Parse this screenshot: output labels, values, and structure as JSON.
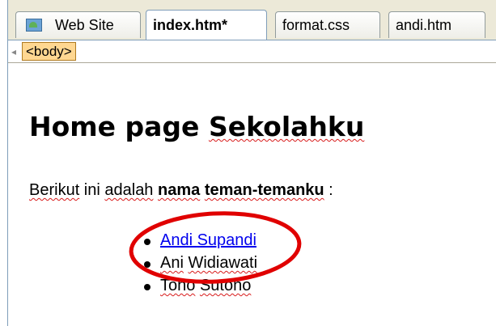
{
  "tabs": [
    {
      "label": "Web Site",
      "active": false
    },
    {
      "label": "index.htm*",
      "active": true
    },
    {
      "label": "format.css",
      "active": false
    },
    {
      "label": "andi.htm",
      "active": false
    }
  ],
  "tag_selector": {
    "tag": "<body>"
  },
  "page": {
    "heading_part1": "Home page ",
    "heading_part2": "Sekolahku",
    "intro_1": "Berikut",
    "intro_2": " ini ",
    "intro_3": "adalah",
    "intro_4": "nama",
    "intro_5": "teman-temanku",
    "intro_6": " :",
    "friends": [
      {
        "first": "Andi",
        "last": "Supandi",
        "is_link": true
      },
      {
        "first": "Ani",
        "last": "Widiawati",
        "is_link": false
      },
      {
        "first": "Tono",
        "last": "Sutono",
        "is_link": false
      }
    ]
  },
  "annotation": {
    "color": "#e00000",
    "target": "Andi Supandi"
  },
  "colors": {
    "link": "#0000ee",
    "spellcheck": "#d81b1b",
    "tag_bg": "#ffd791"
  }
}
